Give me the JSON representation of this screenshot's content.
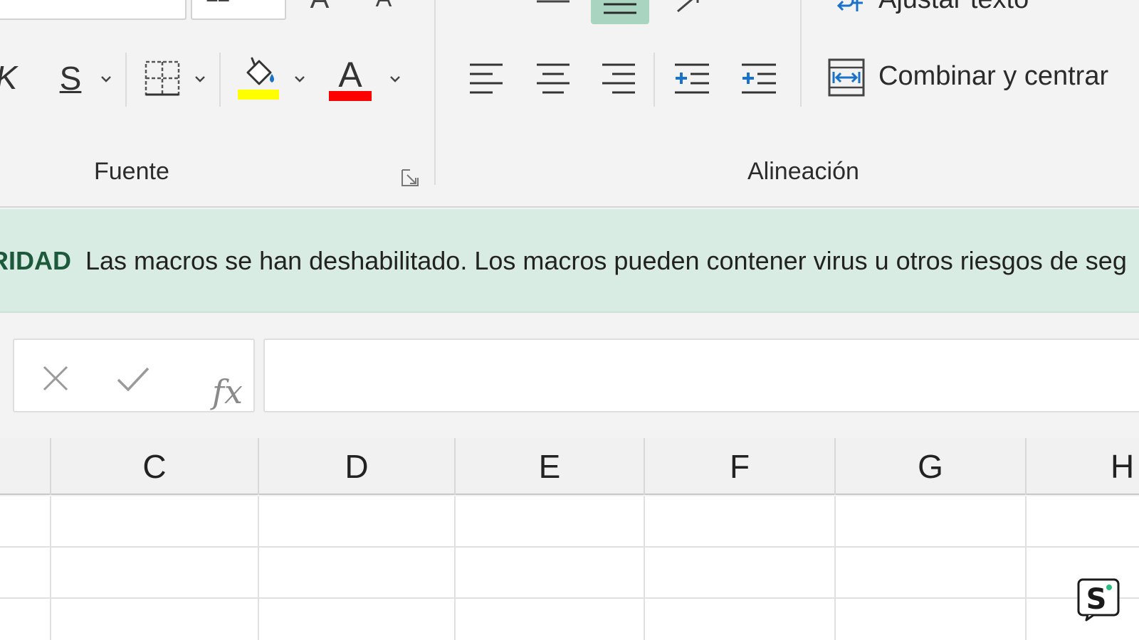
{
  "ribbon": {
    "font_group_label": "Fuente",
    "alignment_group_label": "Alineación",
    "merge_center_label": "Combinar y centrar",
    "wrap_text_label": "Ajustar texto",
    "highlight_color": "#ffff00",
    "font_color": "#ff0000"
  },
  "message_bar": {
    "title": "RIDAD",
    "text": "Las macros se han deshabilitado.  Los macros pueden contener virus u otros riesgos de seg"
  },
  "formula_bar": {
    "fx_label": "fx",
    "value": ""
  },
  "sheet": {
    "columns": [
      "C",
      "D",
      "E",
      "F",
      "G",
      "H"
    ]
  },
  "colors": {
    "message_bar_bg": "#d9ece4",
    "accent_green": "#1d5a3c",
    "indent_blue": "#1a73c9"
  },
  "watermark_letter": "S"
}
